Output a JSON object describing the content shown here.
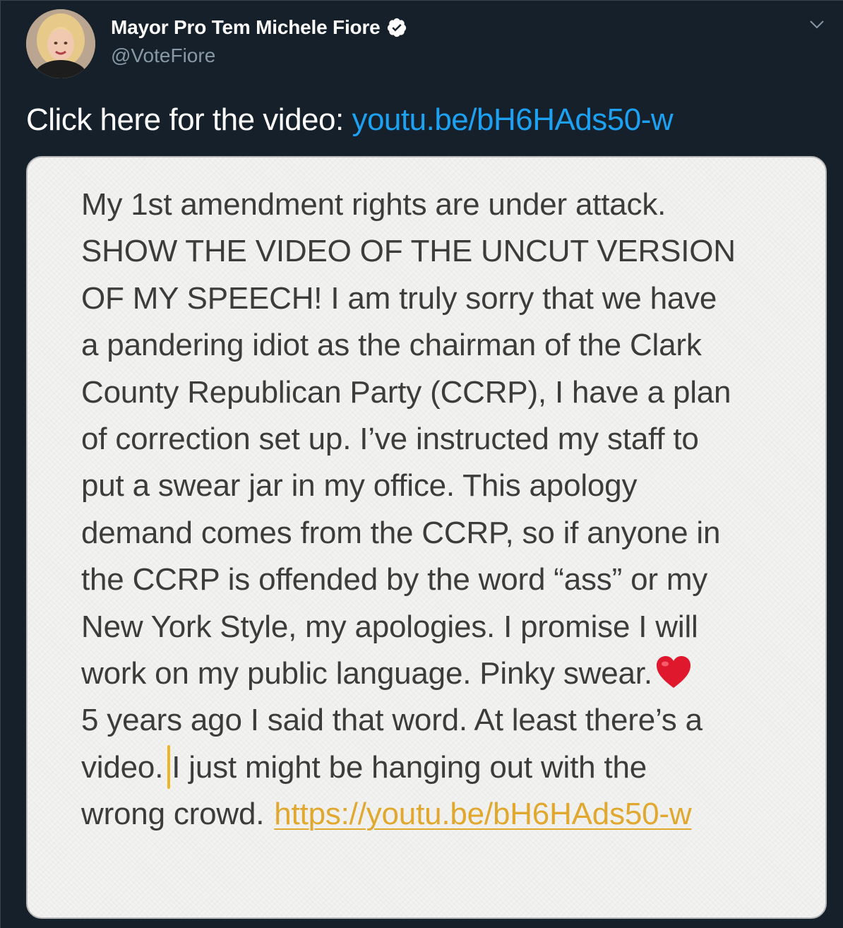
{
  "author": {
    "display_name": "Mayor Pro Tem Michele Fiore",
    "handle": "@VoteFiore",
    "verified_icon": "verified-badge-icon"
  },
  "tweet": {
    "text_prefix": "Click here for the video: ",
    "link_text": "youtu.be/bH6HAds50-w"
  },
  "media_note": {
    "lines": [
      "My 1st amendment rights are under attack.",
      "SHOW THE VIDEO OF THE UNCUT VERSION",
      "OF MY SPEECH! I am truly sorry that we have",
      "a pandering idiot as the chairman of the Clark",
      "County Republican Party (CCRP), I have a plan",
      "of correction set up. I’ve instructed my staff to",
      "put a swear jar in my office. This apology",
      "demand comes from the CCRP, so if anyone in",
      "the CCRP is offended by the word “ass” or my",
      "New York Style, my apologies. I promise I will"
    ],
    "line_heart_prefix": "work on my public language. Pinky swear.",
    "line_12": "5 years ago I said that word. At least there’s a",
    "line_13_a": "video.",
    "line_13_b": "I just might be hanging out with the",
    "line_14_prefix": "wrong crowd.",
    "link_text": "https://youtu.be/bH6HAds50-w",
    "icons": [
      "red-heart-icon",
      "text-cursor"
    ]
  },
  "colors": {
    "background": "#15202b",
    "link": "#1da1f2",
    "note_link": "#e0a82e",
    "cursor": "#f0b429",
    "heart": "#e0182d"
  }
}
